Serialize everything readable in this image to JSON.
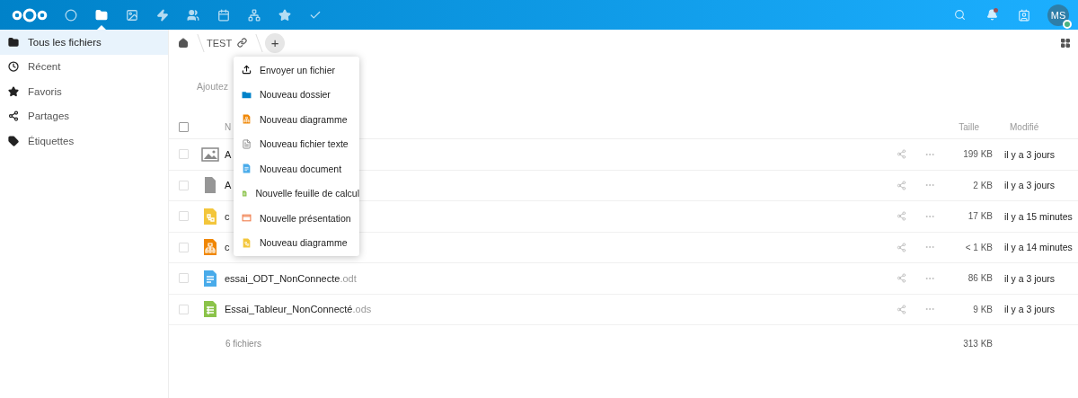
{
  "top_bar": {
    "apps": [
      {
        "kind": "circle",
        "selected": false
      },
      {
        "kind": "folder",
        "selected": true
      },
      {
        "kind": "image",
        "selected": false
      },
      {
        "kind": "bolt",
        "selected": false
      },
      {
        "kind": "people",
        "selected": false
      },
      {
        "kind": "calendar",
        "selected": false
      },
      {
        "kind": "network",
        "selected": false
      },
      {
        "kind": "star",
        "selected": false
      },
      {
        "kind": "check",
        "selected": false
      }
    ],
    "notifications_unread": true,
    "avatar": {
      "initials": "MS",
      "online": true
    }
  },
  "sidebar": {
    "items": [
      {
        "label": "Tous les fichiers",
        "kind": "folder",
        "selected": true
      },
      {
        "label": "Récent",
        "kind": "clock",
        "selected": false
      },
      {
        "label": "Favoris",
        "kind": "star",
        "selected": false
      },
      {
        "label": "Partages",
        "kind": "share",
        "selected": false
      },
      {
        "label": "Étiquettes",
        "kind": "tag",
        "selected": false
      }
    ]
  },
  "breadcrumb": {
    "items": [
      "TEST"
    ],
    "new_button": "+"
  },
  "new_menu": {
    "items": [
      {
        "label": "Envoyer un fichier",
        "kind": "upload"
      },
      {
        "label": "Nouveau dossier",
        "kind": "folder"
      },
      {
        "label": "Nouveau diagramme",
        "kind": "drawio"
      },
      {
        "label": "Nouveau fichier texte",
        "kind": "text"
      },
      {
        "label": "Nouveau document",
        "kind": "document"
      },
      {
        "label": "Nouvelle feuille de calcul",
        "kind": "spreadsheet"
      },
      {
        "label": "Nouvelle présentation",
        "kind": "presentation"
      },
      {
        "label": "Nouveau diagramme",
        "kind": "diagram"
      }
    ]
  },
  "hint": "Ajoutez",
  "table": {
    "columns": [
      "N",
      "Taille",
      "Modifié"
    ],
    "all_checked": false,
    "rows": [
      {
        "name": "A",
        "ext": "",
        "kind": "image",
        "checked": false,
        "size": "199 KB",
        "modified": "il y a 3 jours"
      },
      {
        "name": "A",
        "ext": "",
        "kind": "file",
        "checked": false,
        "size": "2 KB",
        "modified": "il y a 3 jours"
      },
      {
        "name": "c",
        "ext": "",
        "kind": "diagram",
        "checked": false,
        "size": "17 KB",
        "modified": "il y a 15 minutes"
      },
      {
        "name": "c",
        "ext": "",
        "kind": "drawio",
        "checked": false,
        "size": "< 1 KB",
        "modified": "il y a 14 minutes"
      },
      {
        "name": "essai_ODT_NonConnecte",
        "ext": ".odt",
        "kind": "document",
        "checked": false,
        "size": "86 KB",
        "modified": "il y a 3 jours"
      },
      {
        "name": "Essai_Tableur_NonConnecté",
        "ext": ".ods",
        "kind": "spreadsheet",
        "checked": false,
        "size": "9 KB",
        "modified": "il y a 3 jours"
      }
    ],
    "summary": {
      "count": "6 fichiers",
      "total": "313 KB"
    }
  }
}
